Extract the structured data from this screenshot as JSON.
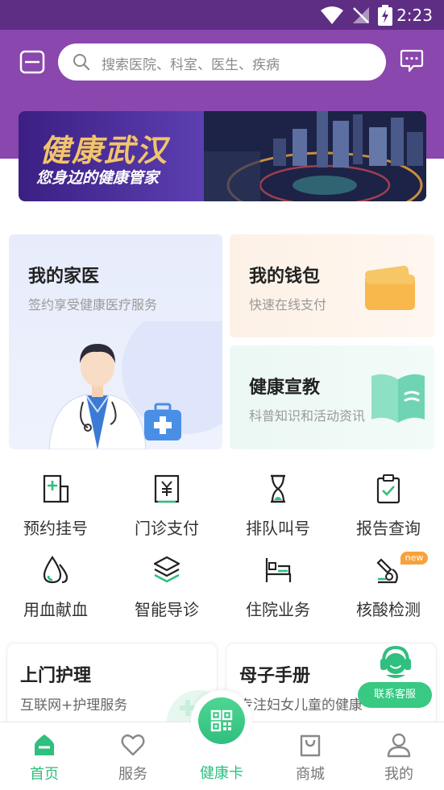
{
  "status_bar": {
    "time": "2:23"
  },
  "header": {
    "search_placeholder": "搜索医院、科室、医生、疾病"
  },
  "banner": {
    "title": "健康武汉",
    "subtitle": "您身边的健康管家"
  },
  "feature_cards": {
    "doctor": {
      "title": "我的家医",
      "subtitle": "签约享受健康医疗服务"
    },
    "wallet": {
      "title": "我的钱包",
      "subtitle": "快速在线支付"
    },
    "education": {
      "title": "健康宣教",
      "subtitle": "科普知识和活动资讯"
    }
  },
  "services": [
    {
      "label": "预约挂号",
      "icon": "hospital-icon"
    },
    {
      "label": "门诊支付",
      "icon": "yuan-receipt-icon"
    },
    {
      "label": "排队叫号",
      "icon": "hourglass-icon"
    },
    {
      "label": "报告查询",
      "icon": "clipboard-check-icon"
    },
    {
      "label": "用血献血",
      "icon": "blood-drop-icon"
    },
    {
      "label": "智能导诊",
      "icon": "layers-icon"
    },
    {
      "label": "住院业务",
      "icon": "hospital-bed-icon"
    },
    {
      "label": "核酸检测",
      "icon": "microscope-icon",
      "badge": "new"
    }
  ],
  "bottom_cards": {
    "nursing": {
      "title": "上门护理",
      "subtitle": "互联网+护理服务"
    },
    "maternal": {
      "title": "母子手册",
      "subtitle": "专注妇女儿童的健康"
    }
  },
  "customer_service": {
    "label": "联系客服"
  },
  "tabs": [
    {
      "label": "首页",
      "icon": "home-icon",
      "active": true
    },
    {
      "label": "服务",
      "icon": "heart-icon",
      "active": false
    },
    {
      "label": "健康卡",
      "icon": "qr-code-icon",
      "active": false
    },
    {
      "label": "商城",
      "icon": "shopping-bag-icon",
      "active": false
    },
    {
      "label": "我的",
      "icon": "user-icon",
      "active": false
    }
  ],
  "colors": {
    "header_purple": "#8a47ad",
    "status_purple": "#5e2d84",
    "accent_green": "#2fbf7e",
    "badge_orange": "#f7a23a"
  }
}
